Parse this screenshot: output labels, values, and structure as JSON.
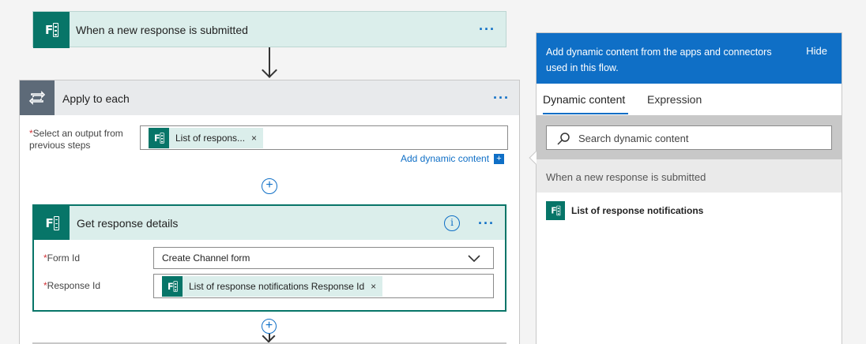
{
  "trigger": {
    "title": "When a new response is submitted",
    "menu": "···"
  },
  "apply_to_each": {
    "title": "Apply to each",
    "menu": "···",
    "select_label_star": "*",
    "select_label": "Select an output from previous steps",
    "token_text": "List of respons...",
    "token_close": "×",
    "add_dynamic": "Add dynamic content",
    "add_dynamic_icon": "+",
    "add_step": "+"
  },
  "get_details": {
    "title": "Get response details",
    "info": "i",
    "menu": "···",
    "form_id_star": "*",
    "form_id_label": "Form Id",
    "form_id_value": "Create Channel form",
    "response_id_star": "*",
    "response_id_label": "Response Id",
    "response_token": "List of response notifications Response Id",
    "response_token_close": "×",
    "add_step": "+"
  },
  "panel": {
    "header_msg": "Add dynamic content from the apps and connectors used in this flow.",
    "hide": "Hide",
    "tabs": [
      "Dynamic content",
      "Expression"
    ],
    "search_placeholder": "Search dynamic content",
    "section_title": "When a new response is submitted",
    "item_label": "List of response notifications"
  },
  "colors": {
    "forms_green": "#077568",
    "accent_blue": "#0f6fc6",
    "loop_gray": "#5d6a78"
  }
}
